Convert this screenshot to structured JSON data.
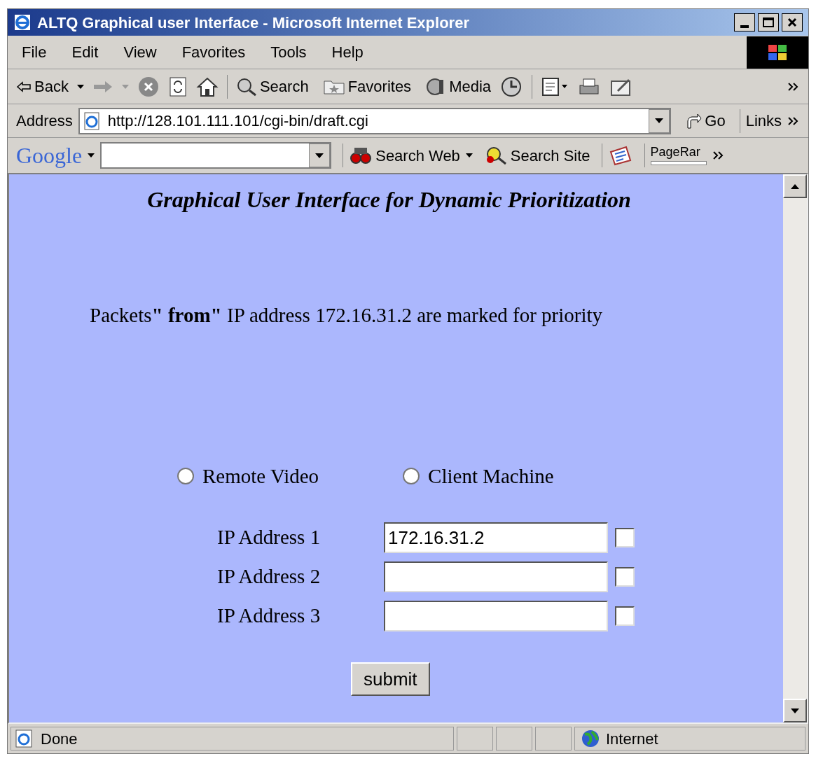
{
  "window": {
    "title": "ALTQ Graphical user Interface - Microsoft Internet Explorer"
  },
  "menu": [
    "File",
    "Edit",
    "View",
    "Favorites",
    "Tools",
    "Help"
  ],
  "toolbar": {
    "back": "Back",
    "search": "Search",
    "favorites": "Favorites",
    "media": "Media"
  },
  "address_bar": {
    "label": "Address",
    "url": "http://128.101.111.101/cgi-bin/draft.cgi",
    "go": "Go",
    "links": "Links"
  },
  "google_bar": {
    "logo": "Google",
    "search_web": "Search Web",
    "search_site": "Search Site",
    "pagerank": "PageRar"
  },
  "page": {
    "heading": "Graphical User Interface for Dynamic Prioritization",
    "message": "Packets**\" from\"** IP address 172.16.31.2 are marked for priority",
    "radios": [
      {
        "label": "Remote Video",
        "selected": false
      },
      {
        "label": "Client Machine",
        "selected": false
      }
    ],
    "ip_rows": [
      {
        "label": "IP Address 1",
        "value": "172.16.31.2",
        "checked": false
      },
      {
        "label": "IP Address 2",
        "checked": false
      },
      {
        "label": "IP Address 3",
        "checked": false
      }
    ],
    "submit": "submit"
  },
  "status_bar": {
    "text": "Done",
    "zone": "Internet"
  }
}
